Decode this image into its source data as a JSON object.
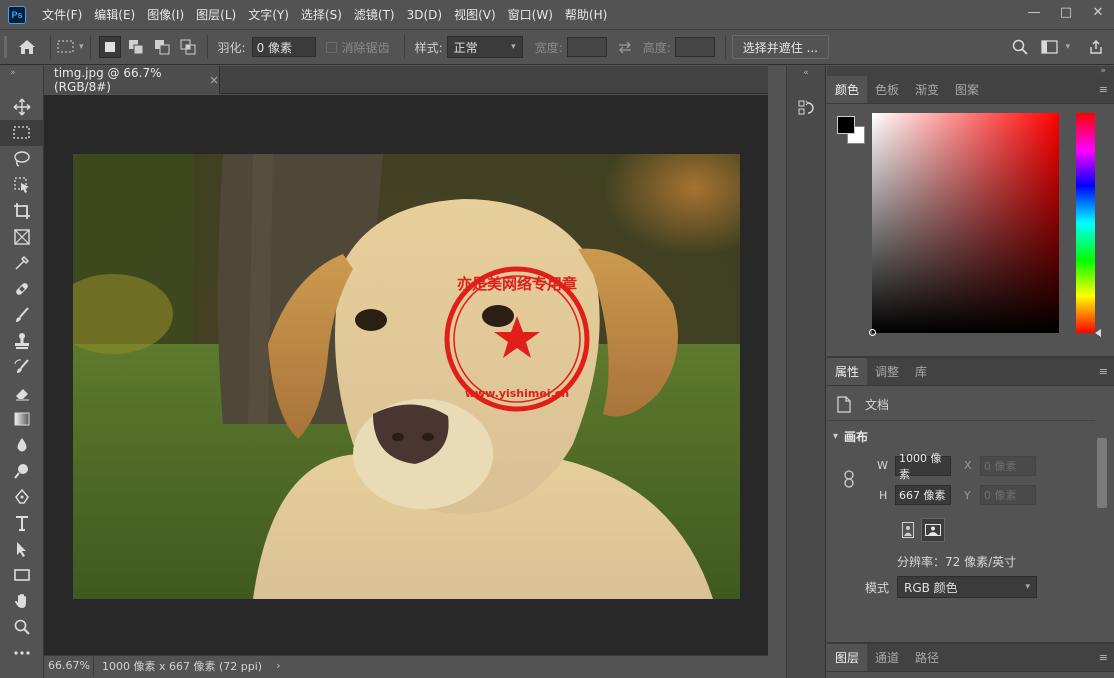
{
  "app": {
    "logo_text": "Ps"
  },
  "menu": [
    "文件(F)",
    "编辑(E)",
    "图像(I)",
    "图层(L)",
    "文字(Y)",
    "选择(S)",
    "滤镜(T)",
    "3D(D)",
    "视图(V)",
    "窗口(W)",
    "帮助(H)"
  ],
  "window_controls": {
    "minimize": "—",
    "maximize": "□",
    "close": "✕"
  },
  "options": {
    "feather_label": "羽化:",
    "feather_value": "0 像素",
    "antialias_label": "消除锯齿",
    "style_label": "样式:",
    "style_value": "正常",
    "width_label": "宽度:",
    "height_label": "高度:",
    "select_mask_button": "选择并遮住 ..."
  },
  "document": {
    "tab_title": "timg.jpg @ 66.7%(RGB/8#)",
    "tab_close": "×",
    "watermark_top_text": "亦是美网络专用章",
    "watermark_bottom_text": "www.yishimei.cn",
    "status_zoom": "66.67%",
    "status_info": "1000 像素 x 667 像素 (72 ppi)",
    "status_arrow": "›"
  },
  "color_panel": {
    "tabs": [
      "颜色",
      "色板",
      "渐变",
      "图案"
    ],
    "foreground": "#000000",
    "background": "#ffffff",
    "hue_color": "#ff0000"
  },
  "properties_panel": {
    "tabs": [
      "属性",
      "调整",
      "库"
    ],
    "doc_label": "文档",
    "section_title": "画布",
    "w_label": "W",
    "w_value": "1000 像素",
    "h_label": "H",
    "h_value": "667 像素",
    "x_label": "X",
    "x_placeholder": "0 像素",
    "y_label": "Y",
    "y_placeholder": "0 像素",
    "resolution": "分辨率：72 像素/英寸",
    "mode_label": "模式",
    "mode_value": "RGB 颜色"
  },
  "layers_panel": {
    "tabs": [
      "图层",
      "通道",
      "路径"
    ]
  }
}
